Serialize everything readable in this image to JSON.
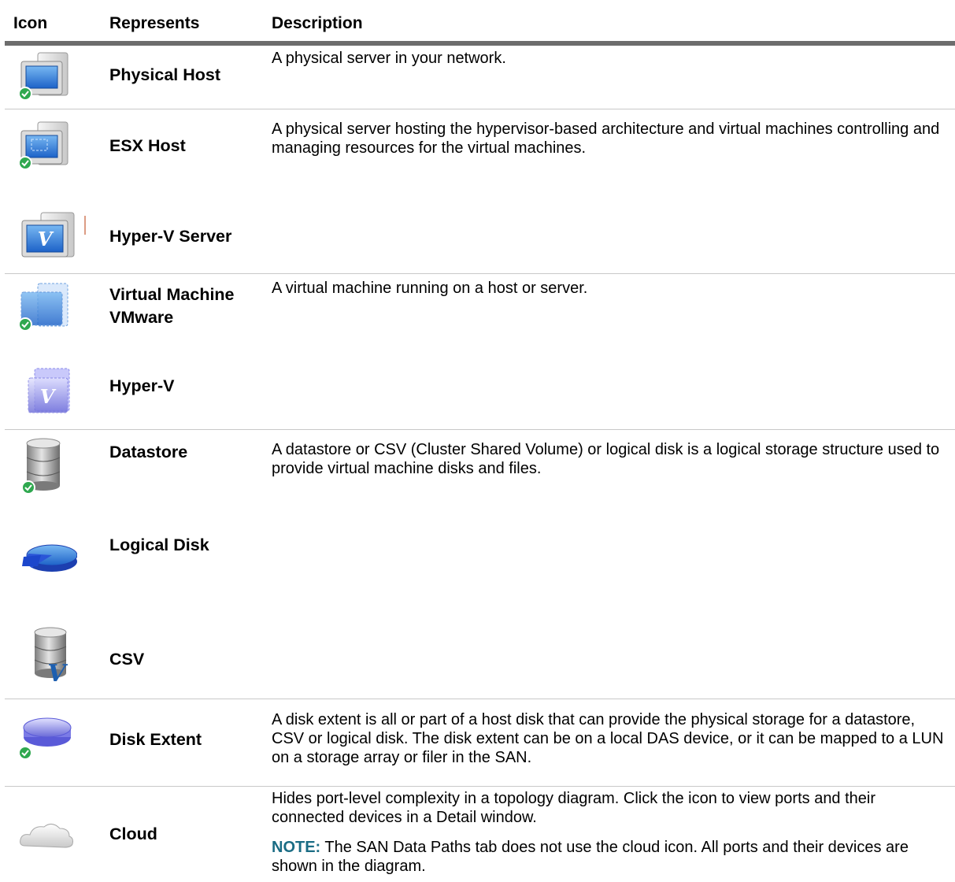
{
  "header": {
    "icon": "Icon",
    "represents": "Represents",
    "description": "Description"
  },
  "rows": [
    {
      "icon": "physical-host-icon",
      "represents": "Physical Host",
      "description": "A physical server in your network."
    },
    {
      "icon": "esx-host-icon",
      "represents": "ESX Host",
      "description": "A physical server hosting the hypervisor-based architecture and virtual machines controlling and managing resources for the virtual machines."
    },
    {
      "icon": "hyper-v-server-icon",
      "represents": "Hyper-V Server",
      "description": ""
    },
    {
      "icon": "virtual-machine-icon",
      "represents": "Virtual Machine VMware",
      "description": "A virtual machine running on a host or server."
    },
    {
      "icon": "hyper-v-vm-icon",
      "represents": "Hyper-V",
      "description": ""
    },
    {
      "icon": "datastore-icon",
      "represents": "Datastore",
      "description": "A datastore or CSV (Cluster Shared Volume) or logical disk is a logical storage structure used to provide virtual machine disks and files."
    },
    {
      "icon": "logical-disk-icon",
      "represents": "Logical Disk",
      "description": ""
    },
    {
      "icon": "csv-icon",
      "represents": "CSV",
      "description": ""
    },
    {
      "icon": "disk-extent-icon",
      "represents": "Disk Extent",
      "description": "A disk extent is all or part of a host disk that can provide the physical storage for a datastore, CSV or logical disk. The disk extent can be on a local DAS device, or it can be mapped to a LUN on a storage array or filer in the SAN."
    },
    {
      "icon": "cloud-icon",
      "represents": "Cloud",
      "description": "Hides port-level complexity in a topology diagram. Click the icon to view ports and their connected devices in a Detail window.",
      "note_label": "NOTE:",
      "note_text": " The SAN Data Paths tab does not use the cloud icon. All ports and their devices are shown in the diagram."
    }
  ],
  "colors": {
    "note_label": "#1a6c84",
    "check_badge": "#2fa84f",
    "header_rule": "#6d6d6d"
  }
}
